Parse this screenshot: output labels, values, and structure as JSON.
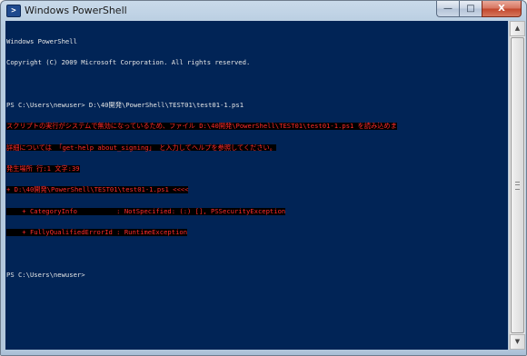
{
  "window": {
    "title": "Windows PowerShell",
    "icon": "powershell-icon"
  },
  "caption_buttons": {
    "minimize": "—",
    "maximize": "□",
    "close": "X"
  },
  "console": {
    "background_color": "#012456",
    "text_color": "#e6e6e6",
    "error_color": "#ff2b2b",
    "banner_line_1": "Windows PowerShell",
    "banner_line_2": "Copyright (C) 2009 Microsoft Corporation. All rights reserved.",
    "command_line": "PS C:\\Users\\newuser> D:\\40開発\\PowerShell\\TEST01\\test01-1.ps1",
    "error_lines": [
      "スクリプトの実行がシステムで無効になっているため、ファイル D:\\40開発\\PowerShell\\TEST01\\test01-1.ps1 を読み込めま",
      "詳細については 「get-help about_signing」 と入力してヘルプを参照してください。",
      "発生場所 行:1 文字:39",
      "+ D:\\40開発\\PowerShell\\TEST01\\test01-1.ps1 <<<<",
      "    + CategoryInfo          : NotSpecified: (:) [], PSSecurityException",
      "    + FullyQualifiedErrorId : RuntimeException"
    ],
    "final_prompt": "PS C:\\Users\\newuser>"
  },
  "scrollbar": {
    "up_arrow": "▲",
    "down_arrow": "▼"
  }
}
